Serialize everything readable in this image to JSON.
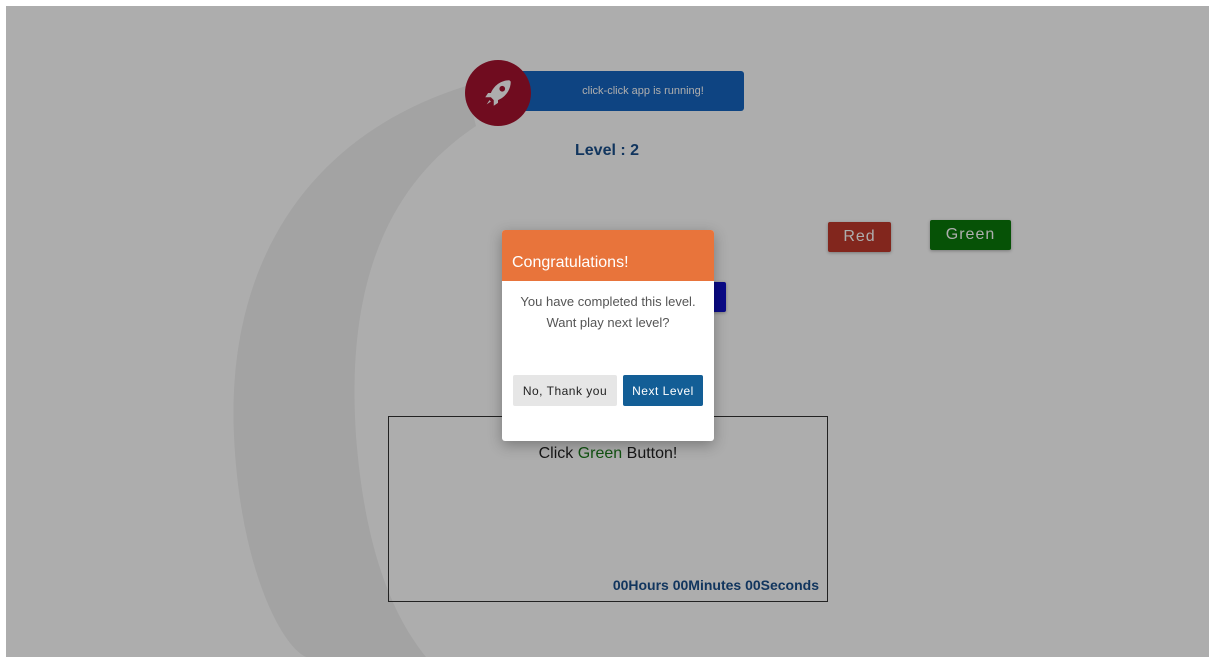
{
  "app": {
    "banner_text": "click-click app is running!",
    "banner_color": "#1565c0",
    "rocket_badge_color": "#a6122f",
    "rocket_icon": "rocket-icon"
  },
  "game": {
    "level_text": "Level : 2",
    "level_color": "#1a4f8b",
    "buttons": {
      "red": {
        "label": "Red",
        "color": "#c0392b"
      },
      "green": {
        "label": "Green",
        "color": "#0a7a0a"
      },
      "blue": {
        "label": "",
        "color": "#1010c8"
      }
    },
    "instruction": {
      "prefix": "Click ",
      "target": "Green",
      "suffix": " Button!",
      "target_color": "#1a7a1a"
    },
    "timer": {
      "text": "00Hours 00Minutes 00Seconds",
      "color": "#1a4f8b"
    }
  },
  "modal": {
    "title": "Congratulations!",
    "header_color": "#e8743b",
    "message": "You have completed this level. Want play next level?",
    "decline_label": "No, Thank you",
    "confirm_label": "Next Level",
    "confirm_color": "#135e96"
  }
}
